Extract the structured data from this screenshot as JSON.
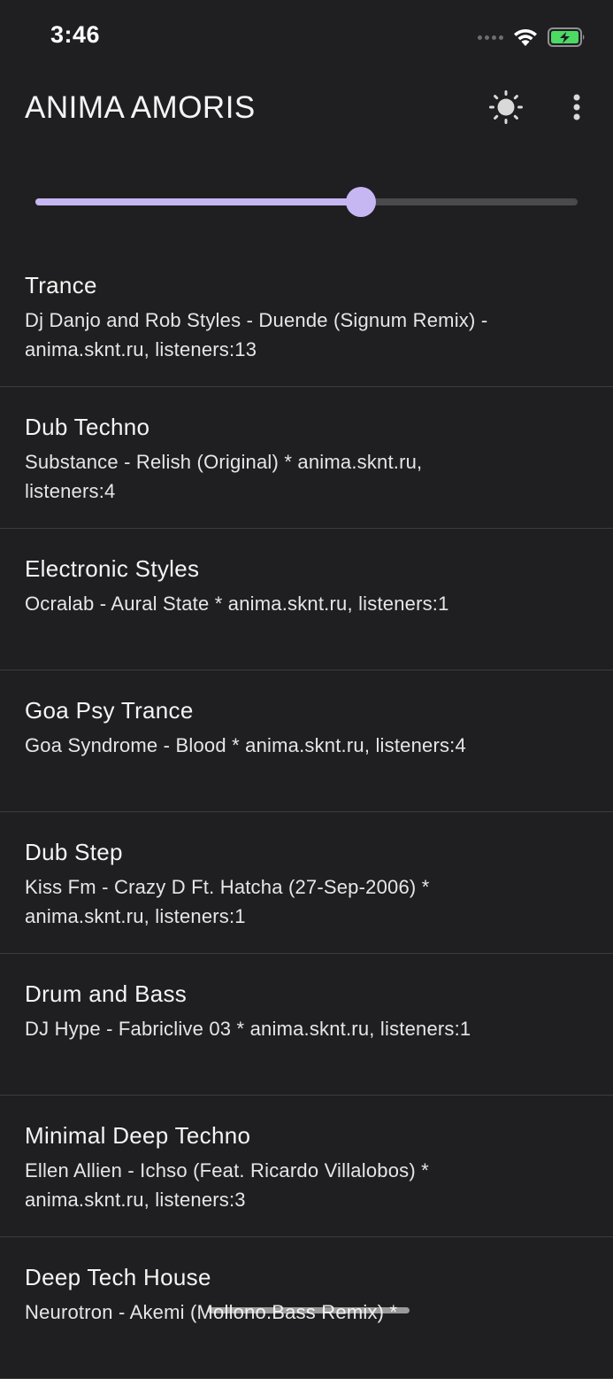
{
  "status_bar": {
    "time": "3:46",
    "wifi_icon": "wifi-icon",
    "battery_icon": "battery-charging-icon",
    "battery_color": "#4cd964"
  },
  "app_bar": {
    "title": "ANIMA AMORIS",
    "theme_icon": "brightness-icon",
    "menu_icon": "more-vert-icon"
  },
  "volume_slider": {
    "value": 0.6,
    "active_color": "#c6b7f3",
    "inactive_color": "#4a4a4e"
  },
  "stations": [
    {
      "name": "Trance",
      "track": "Dj Danjo and Rob Styles - Duende (Signum Remix) - anima.sknt.ru, listeners:13"
    },
    {
      "name": "Dub Techno",
      "track": "Substance - Relish (Original) * anima.sknt.ru, listeners:4"
    },
    {
      "name": "Electronic Styles",
      "track": "Ocralab - Aural State * anima.sknt.ru, listeners:1"
    },
    {
      "name": "Goa Psy Trance",
      "track": "Goa Syndrome - Blood * anima.sknt.ru, listeners:4"
    },
    {
      "name": "Dub Step",
      "track": "Kiss Fm - Crazy D Ft. Hatcha (27-Sep-2006) * anima.sknt.ru, listeners:1"
    },
    {
      "name": "Drum and Bass",
      "track": "DJ Hype - Fabriclive 03 * anima.sknt.ru, listeners:1"
    },
    {
      "name": "Minimal Deep Techno",
      "track": "Ellen Allien - Ichso (Feat. Ricardo Villalobos) * anima.sknt.ru, listeners:3"
    },
    {
      "name": "Deep Tech House",
      "track": "Neurotron - Akemi (Mollono.Bass Remix) *"
    }
  ]
}
